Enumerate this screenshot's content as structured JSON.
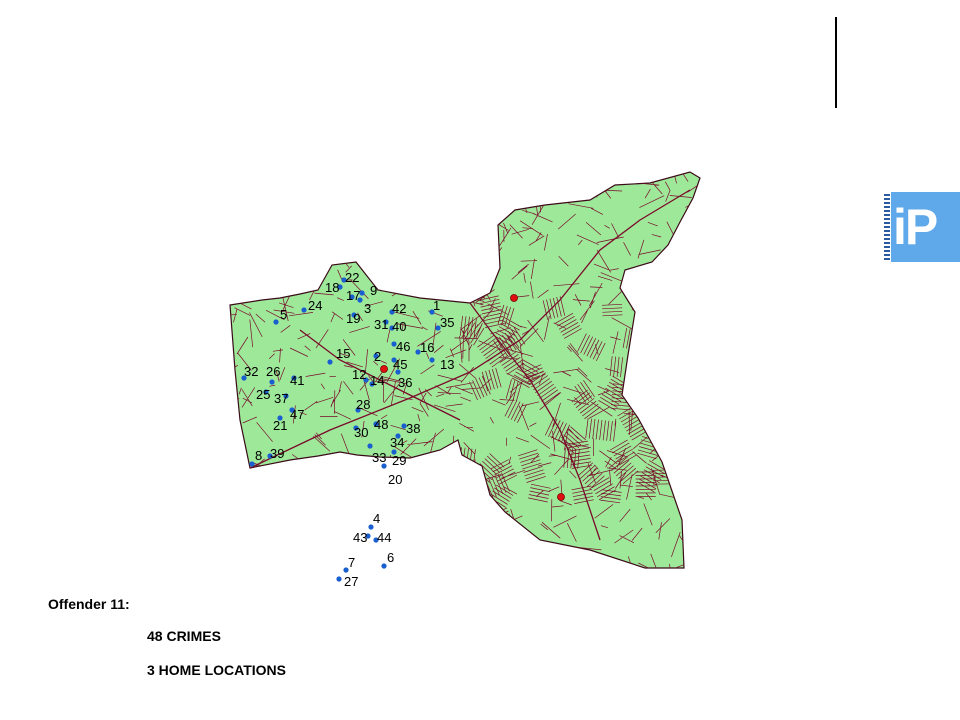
{
  "logo": {
    "text": "iP",
    "color": "#5fa9ea"
  },
  "map": {
    "land_color": "#9ee89a",
    "street_color": "#7a0a2a",
    "crime_marker_color": "#1a5fd0",
    "home_marker_color": "#e01010",
    "crimes": [
      {
        "label": "1"
      },
      {
        "label": "2"
      },
      {
        "label": "3"
      },
      {
        "label": "4"
      },
      {
        "label": "5"
      },
      {
        "label": "6"
      },
      {
        "label": "7"
      },
      {
        "label": "8"
      },
      {
        "label": "9"
      },
      {
        "label": "12"
      },
      {
        "label": "13"
      },
      {
        "label": "14"
      },
      {
        "label": "15"
      },
      {
        "label": "16"
      },
      {
        "label": "17"
      },
      {
        "label": "18"
      },
      {
        "label": "19"
      },
      {
        "label": "20"
      },
      {
        "label": "21"
      },
      {
        "label": "22"
      },
      {
        "label": "24"
      },
      {
        "label": "25"
      },
      {
        "label": "26"
      },
      {
        "label": "27"
      },
      {
        "label": "28"
      },
      {
        "label": "29"
      },
      {
        "label": "30"
      },
      {
        "label": "31"
      },
      {
        "label": "32"
      },
      {
        "label": "33"
      },
      {
        "label": "34"
      },
      {
        "label": "35"
      },
      {
        "label": "36"
      },
      {
        "label": "37"
      },
      {
        "label": "38"
      },
      {
        "label": "39"
      },
      {
        "label": "40"
      },
      {
        "label": "41"
      },
      {
        "label": "42"
      },
      {
        "label": "43"
      },
      {
        "label": "44"
      },
      {
        "label": "45"
      },
      {
        "label": "46"
      },
      {
        "label": "47"
      },
      {
        "label": "48"
      }
    ]
  },
  "caption": {
    "offender": "Offender 11:",
    "crimes": "48 CRIMES",
    "homes": "3 HOME LOCATIONS"
  }
}
